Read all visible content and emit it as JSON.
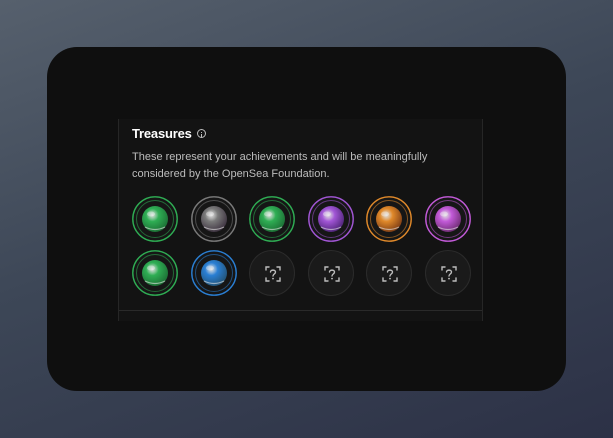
{
  "treasures": {
    "title": "Treasures",
    "info_icon": "info-icon",
    "description": "These represent your achievements and will be meaningfully considered by the OpenSea Foundation.",
    "badges": [
      {
        "state": "earned",
        "ring": "#2fae54",
        "core": "#1b6b33",
        "icon": "green-orb-badge-icon"
      },
      {
        "state": "earned",
        "ring": "#7a7a7a",
        "core": "#3a2f3d",
        "icon": "purple-crystal-badge-icon"
      },
      {
        "state": "earned",
        "ring": "#2fae54",
        "core": "#1b6b33",
        "icon": "green-creature-badge-icon"
      },
      {
        "state": "earned",
        "ring": "#a256d6",
        "core": "#4a2273",
        "icon": "purple-eye-badge-icon"
      },
      {
        "state": "earned",
        "ring": "#e0892a",
        "core": "#7a3a14",
        "icon": "fire-badge-icon"
      },
      {
        "state": "earned",
        "ring": "#c25ad8",
        "core": "#6b2b6e",
        "icon": "pink-chest-badge-icon"
      },
      {
        "state": "earned",
        "ring": "#2fae54",
        "core": "#1b6b33",
        "icon": "green-creature-badge-icon"
      },
      {
        "state": "earned",
        "ring": "#2a7fd4",
        "core": "#23506f",
        "icon": "blue-orb-badge-icon"
      },
      {
        "state": "locked",
        "icon": "unknown-badge-icon"
      },
      {
        "state": "locked",
        "icon": "unknown-badge-icon"
      },
      {
        "state": "locked",
        "icon": "unknown-badge-icon"
      },
      {
        "state": "locked",
        "icon": "unknown-badge-icon"
      }
    ]
  }
}
